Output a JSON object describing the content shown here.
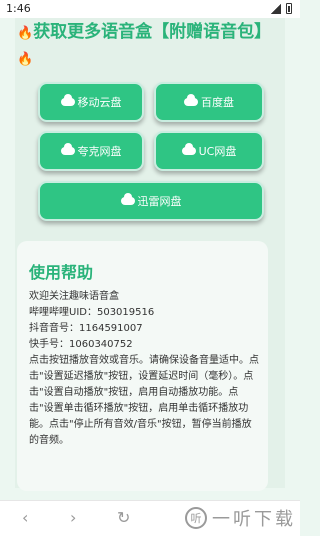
{
  "status_bar": {
    "time": "1:46"
  },
  "header": {
    "title": "获取更多语音盒【附赠语音包】",
    "fire_icon": "fire-emoji"
  },
  "cloud_buttons": {
    "mobile": "移动云盘",
    "baidu": "百度盘",
    "quark": "夸克网盘",
    "uc": "UC网盘",
    "xunlei": "迅雷网盘"
  },
  "help": {
    "title": "使用帮助",
    "lines": [
      "欢迎关注趣味语音盒",
      "哔哩哔哩UID：503019516",
      "抖音音号：1164591007",
      "快手号：1060340752",
      "点击按钮播放音效或音乐。请确保设备音量适中。点击\"设置延迟播放\"按钮，设置延迟时间（毫秒）。点击\"设置自动播放\"按钮，启用自动播放功能。点击\"设置单击循环播放\"按钮，启用单击循环播放功能。点击\"停止所有音效/音乐\"按钮，暂停当前播放的音频。"
    ]
  },
  "nav_bar": {
    "back": "‹",
    "forward": "›",
    "refresh": "↻",
    "watermark_text": "一听下载",
    "watermark_logo": "听"
  },
  "colors": {
    "accent": "#2fc584",
    "title_green": "#2ab37a",
    "background": "#e3f1e9"
  }
}
